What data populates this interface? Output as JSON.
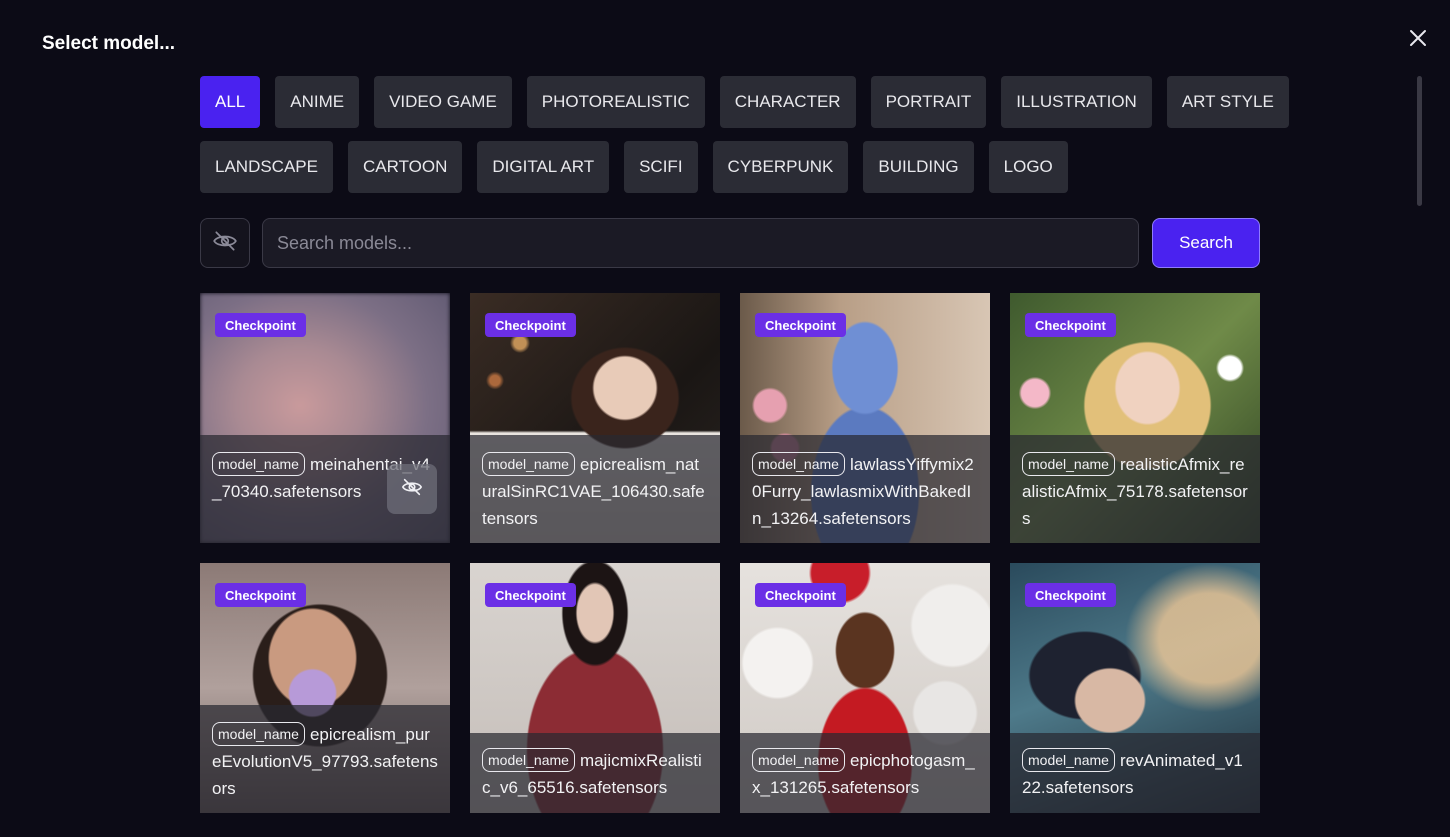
{
  "dialog": {
    "title": "Select model..."
  },
  "filters": {
    "row1": [
      "ALL",
      "ANIME",
      "VIDEO GAME",
      "PHOTOREALISTIC",
      "CHARACTER",
      "PORTRAIT",
      "ILLUSTRATION",
      "ART STYLE"
    ],
    "row2": [
      "LANDSCAPE",
      "CARTOON",
      "DIGITAL ART",
      "SCIFI",
      "CYBERPUNK",
      "BUILDING",
      "LOGO"
    ],
    "active": "ALL"
  },
  "search": {
    "placeholder": "Search models...",
    "button_label": "Search"
  },
  "colors": {
    "accent": "#4a22f0",
    "badge": "#6b2fe6",
    "chip": "#2b2c35"
  },
  "models": [
    {
      "badge": "Checkpoint",
      "tag": "model_name",
      "name": "meinahentai_v4_70340.safetensors"
    },
    {
      "badge": "Checkpoint",
      "tag": "model_name",
      "name": "epicrealism_naturalSinRC1VAE_106430.safetensors"
    },
    {
      "badge": "Checkpoint",
      "tag": "model_name",
      "name": "lawlassYiffymix20Furry_lawlasmixWithBakedIn_13264.safetensors"
    },
    {
      "badge": "Checkpoint",
      "tag": "model_name",
      "name": "realisticAfmix_realisticAfmix_75178.safetensors"
    },
    {
      "badge": "Checkpoint",
      "tag": "model_name",
      "name": "epicrealism_pureEvolutionV5_97793.safetensors"
    },
    {
      "badge": "Checkpoint",
      "tag": "model_name",
      "name": "majicmixRealistic_v6_65516.safetensors"
    },
    {
      "badge": "Checkpoint",
      "tag": "model_name",
      "name": "epicphotogasm_x_131265.safetensors"
    },
    {
      "badge": "Checkpoint",
      "tag": "model_name",
      "name": "revAnimated_v122.safetensors"
    }
  ]
}
